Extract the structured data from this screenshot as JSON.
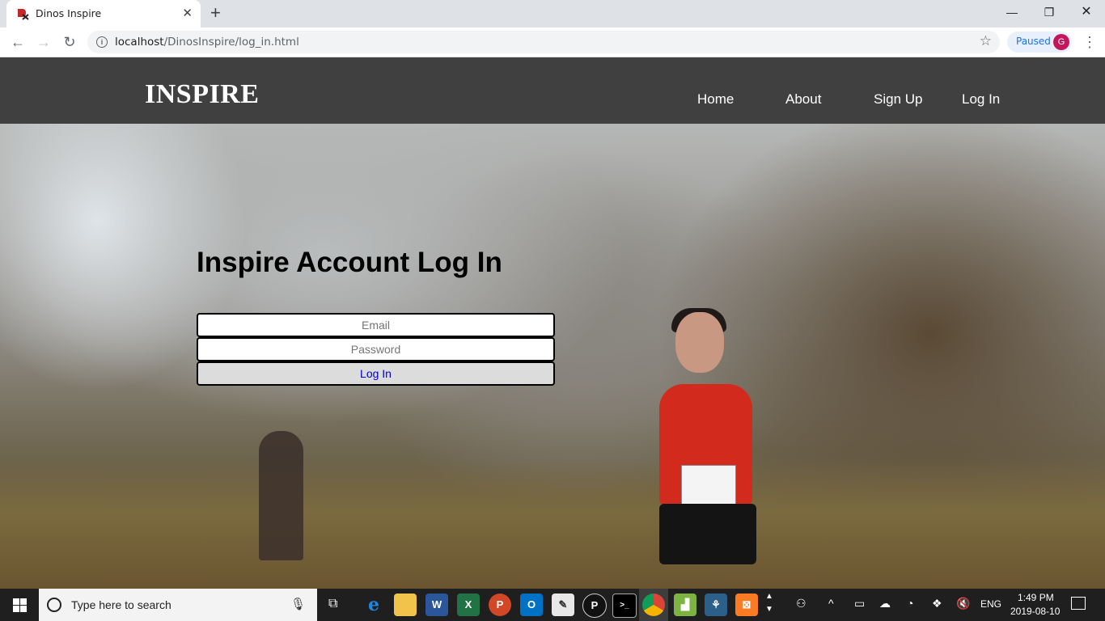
{
  "browser": {
    "tab_title": "Dinos Inspire",
    "url_host": "localhost",
    "url_path": "/DinosInspire/log_in.html",
    "profile_label": "Paused",
    "profile_initial": "G",
    "icons": [
      "back-icon",
      "forward-icon",
      "reload-icon",
      "info-icon",
      "star-icon",
      "menu-icon",
      "minimize-icon",
      "maximize-icon",
      "close-icon"
    ]
  },
  "site": {
    "brand": "INSPIRE",
    "nav": [
      {
        "label": "Home"
      },
      {
        "label": "About"
      },
      {
        "label": "Sign Up"
      },
      {
        "label": "Log In"
      }
    ]
  },
  "login": {
    "title": "Inspire Account Log In",
    "email_placeholder": "Email",
    "password_placeholder": "Password",
    "submit_label": "Log In"
  },
  "taskbar": {
    "search_placeholder": "Type here to search",
    "time": "1:49 PM",
    "date": "2019-08-10",
    "language": "ENG"
  },
  "colors": {
    "header_bg": "#404040",
    "button_text": "#0000cc",
    "accent": "#1a73e8"
  }
}
